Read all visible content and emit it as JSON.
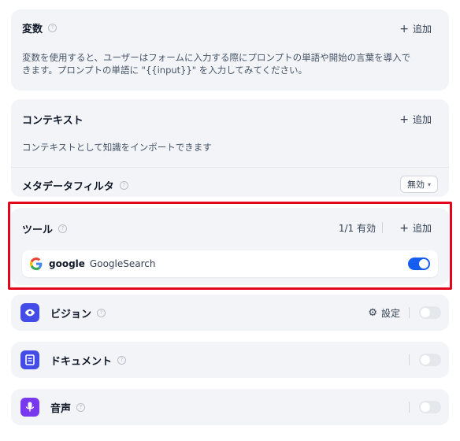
{
  "variables": {
    "title": "変数",
    "add_label": "追加",
    "description_line1": "変数を使用すると、ユーザーはフォームに入力する際にプロンプトの単語や開始の言葉を導入で",
    "description_line2": "きます。プロンプトの単語に \"{{input}}\" を入力してみてください。"
  },
  "context": {
    "title": "コンテキスト",
    "add_label": "追加",
    "description": "コンテキストとして知識をインポートできます",
    "metadata_filter_label": "メタデータフィルタ",
    "metadata_filter_value": "無効"
  },
  "tools": {
    "title": "ツール",
    "enabled_count": "1/1 有効",
    "add_label": "追加",
    "items": [
      {
        "provider": "google",
        "name": "GoogleSearch",
        "enabled": true
      }
    ]
  },
  "vision": {
    "title": "ビジョン",
    "settings_label": "設定",
    "enabled": false
  },
  "document": {
    "title": "ドキュメント",
    "enabled": false
  },
  "audio": {
    "title": "音声",
    "enabled": false
  },
  "colors": {
    "highlight_border": "#e3051b",
    "toggle_on": "#155eef",
    "vision_icon_bg": "#444ce7",
    "document_icon_bg": "#444ce7",
    "audio_icon_bg": "#7839ee"
  }
}
